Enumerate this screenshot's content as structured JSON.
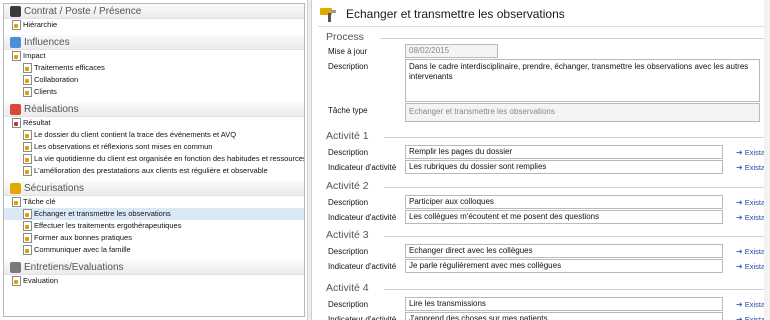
{
  "tree": {
    "sections": [
      {
        "title": "Contrat / Poste / Présence",
        "icon": "book-icon",
        "items": [
          {
            "label": "Hiérarchie",
            "level": 1
          }
        ]
      },
      {
        "title": "Influences",
        "icon": "people-icon",
        "items": [
          {
            "label": "Impact",
            "level": 1
          },
          {
            "label": "Traitements efficaces",
            "level": 2
          },
          {
            "label": "Collaboration",
            "level": 2
          },
          {
            "label": "Clients",
            "level": 2
          }
        ]
      },
      {
        "title": "Réalisations",
        "icon": "target-icon",
        "items": [
          {
            "label": "Résultat",
            "level": 1
          },
          {
            "label": "Le dossier du client contient la trace des événements et AVQ",
            "level": 2
          },
          {
            "label": "Les observations et réflexions sont mises en commun",
            "level": 2
          },
          {
            "label": "La vie quotidienne du client est organisée en fonction des habitudes et ressources du",
            "level": 2
          },
          {
            "label": "L'amélioration des prestatations aux clients est régulière et observable",
            "level": 2
          }
        ]
      },
      {
        "title": "Sécurisations",
        "icon": "tools-icon",
        "items": [
          {
            "label": "Tâche clé",
            "level": 1
          },
          {
            "label": "Echanger et transmettre les observations",
            "level": 2,
            "selected": true
          },
          {
            "label": "Effectuer les traitements ergothérapeutiques",
            "level": 2
          },
          {
            "label": "Former aux bonnes pratiques",
            "level": 2
          },
          {
            "label": "Communiquer avec la famille",
            "level": 2
          }
        ]
      },
      {
        "title": "Entretiens/Evaluations",
        "icon": "interview-icon",
        "items": [
          {
            "label": "Evaluation",
            "level": 1
          }
        ]
      }
    ]
  },
  "main": {
    "title": "Echanger et transmettre les observations",
    "process": {
      "title": "Process",
      "mise_a_jour_label": "Mise à jour",
      "mise_a_jour_value": "08/02/2015",
      "description_label": "Description",
      "description_value": "Dans le cadre interdisciplinaire, prendre, échanger, transmettre les observations avec les autres intervenants",
      "tache_type_label": "Tâche type",
      "tache_type_value": "Echanger et transmettre les observations"
    },
    "activities": [
      {
        "title": "Activité 1",
        "description_label": "Description",
        "description": "Remplir les pages du dossier",
        "indicateur_label": "Indicateur d'activité",
        "indicateur": "Les rubriques du dossier sont remplies"
      },
      {
        "title": "Activité 2",
        "description_label": "Description",
        "description": "Participer aux colloques",
        "indicateur_label": "Indicateur d'activité",
        "indicateur": "Les collègues m'écoutent et me posent des questions"
      },
      {
        "title": "Activité 3",
        "description_label": "Description",
        "description": "Echanger direct avec les collègues",
        "indicateur_label": "Indicateur d'activité",
        "indicateur": "Je parle régulièrement avec mes collègues"
      },
      {
        "title": "Activité 4",
        "description_label": "Description",
        "description": "Lire les transmissions",
        "indicateur_label": "Indicateur d'activité",
        "indicateur": "J'apprend des choses sur mes patients"
      }
    ],
    "link_label": "Existant"
  },
  "colors": {
    "accent": "#1c4f9c",
    "selection": "#dbe9f7",
    "icon_yellow": "#e0a800"
  }
}
